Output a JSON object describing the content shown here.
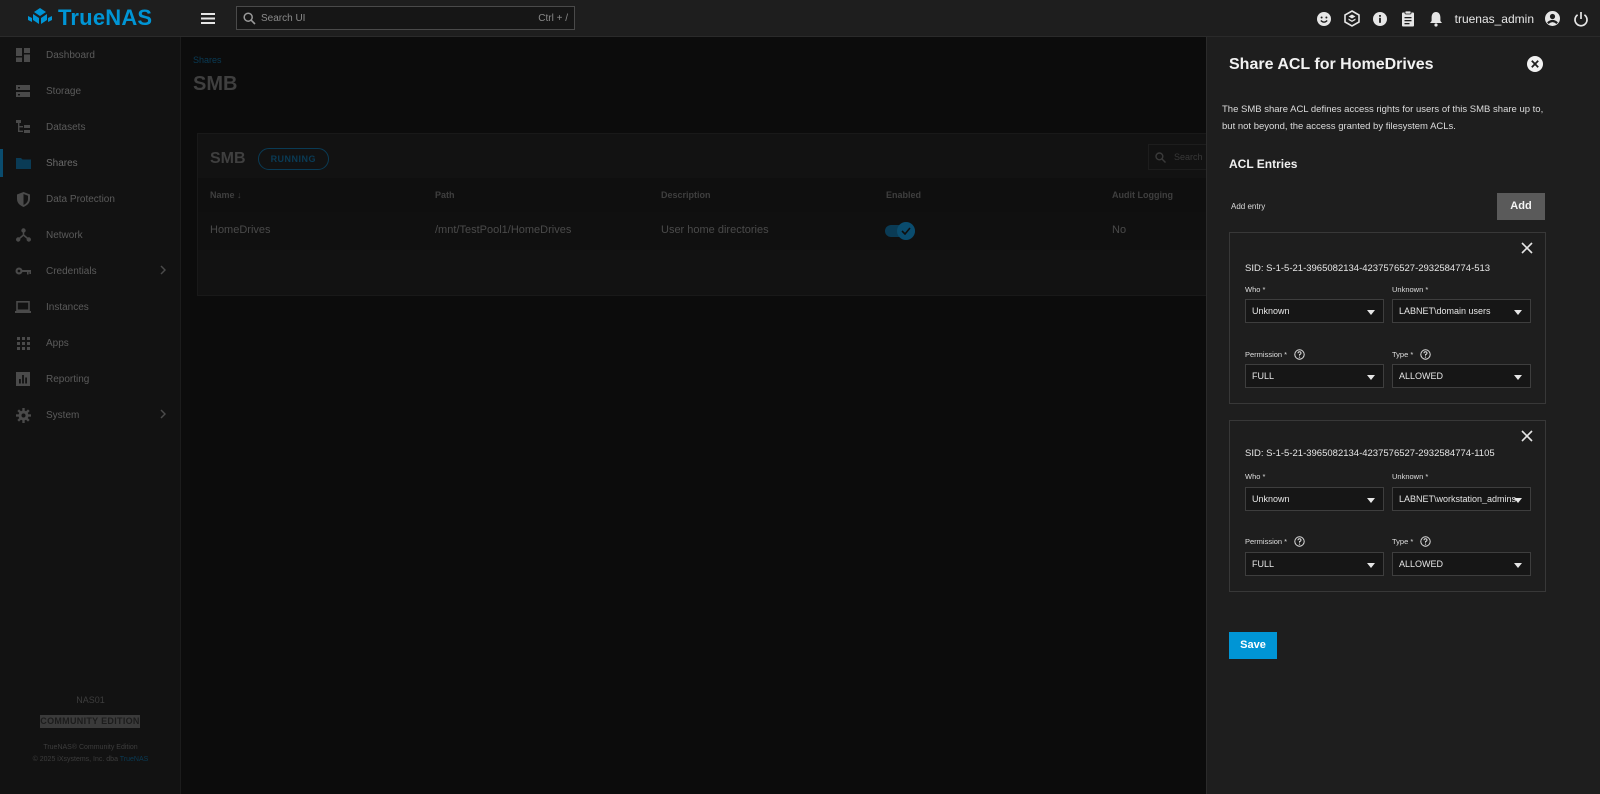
{
  "topbar": {
    "brand": "TrueNAS",
    "search_placeholder": "Search UI",
    "search_shortcut": "Ctrl + /",
    "username": "truenas_admin",
    "icons": [
      "smiley-icon",
      "jobs-icon",
      "info-icon",
      "clipboard-icon",
      "bell-icon",
      "account-icon",
      "power-icon"
    ]
  },
  "sidebar": {
    "items": [
      {
        "label": "Dashboard",
        "icon": "dashboard-icon"
      },
      {
        "label": "Storage",
        "icon": "storage-icon"
      },
      {
        "label": "Datasets",
        "icon": "datasets-icon"
      },
      {
        "label": "Shares",
        "icon": "shares-icon"
      },
      {
        "label": "Data Protection",
        "icon": "shield-icon"
      },
      {
        "label": "Network",
        "icon": "network-icon"
      },
      {
        "label": "Credentials",
        "icon": "key-icon"
      },
      {
        "label": "Instances",
        "icon": "laptop-icon"
      },
      {
        "label": "Apps",
        "icon": "apps-icon"
      },
      {
        "label": "Reporting",
        "icon": "chart-icon"
      },
      {
        "label": "System",
        "icon": "gear-icon"
      }
    ],
    "hostname": "NAS01",
    "edition_badge": "COMMUNITY EDITION",
    "copyright_line1": "TrueNAS® Community Edition",
    "copyright_line2_prefix": "© 2025 iXsystems, Inc. dba ",
    "copyright_link": "TrueNAS"
  },
  "main": {
    "breadcrumb": "Shares",
    "title": "SMB",
    "card": {
      "title": "SMB",
      "status": "RUNNING",
      "search_placeholder": "Search",
      "columns": {
        "name": "Name ↓",
        "path": "Path",
        "description": "Description",
        "enabled": "Enabled",
        "audit": "Audit Logging"
      },
      "row": {
        "name": "HomeDrives",
        "path": "/mnt/TestPool1/HomeDrives",
        "description": "User home directories",
        "enabled": true,
        "audit": "No"
      }
    }
  },
  "panel": {
    "title": "Share ACL for HomeDrives",
    "description": "The SMB share ACL defines access rights for users of this SMB share up to, but not beyond, the access granted by filesystem ACLs.",
    "acl_heading": "ACL Entries",
    "add_entry_label": "Add entry",
    "add_button": "Add",
    "entries": [
      {
        "sid": "SID: S-1-5-21-3965082134-4237576527-2932584774-513",
        "who_label": "Who *",
        "who_value": "Unknown",
        "unknown_label": "Unknown *",
        "unknown_value": "LABNET\\domain users",
        "permission_label": "Permission *",
        "permission_value": "FULL",
        "type_label": "Type *",
        "type_value": "ALLOWED"
      },
      {
        "sid": "SID: S-1-5-21-3965082134-4237576527-2932584774-1105",
        "who_label": "Who *",
        "who_value": "Unknown",
        "unknown_label": "Unknown *",
        "unknown_value": "LABNET\\workstation_admins",
        "permission_label": "Permission *",
        "permission_value": "FULL",
        "type_label": "Type *",
        "type_value": "ALLOWED"
      }
    ],
    "save_button": "Save"
  },
  "colors": {
    "accent": "#0095d5",
    "panel_bg": "#1e1e1e",
    "topbar_bg": "#1e1e1e",
    "overlay_bg": "#0c0c0c"
  }
}
